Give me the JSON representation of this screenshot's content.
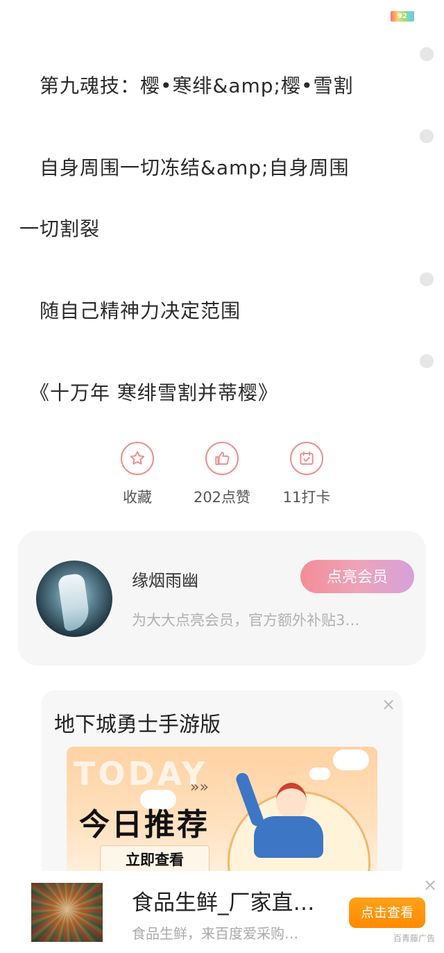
{
  "status": {
    "battery": "92"
  },
  "content": {
    "paragraphs": [
      "　第九魂技：樱•寒绯&amp;樱•雪割",
      "　自身周围一切冻结&amp;自身周围",
      "一切割裂",
      "　随自己精神力决定范围",
      "　《十万年 寒绯雪割并蒂樱》"
    ]
  },
  "actions": [
    {
      "icon": "star-icon",
      "label": "收藏"
    },
    {
      "icon": "thumbs-up-icon",
      "label": "202点赞"
    },
    {
      "icon": "calendar-check-icon",
      "label": "11打卡"
    }
  ],
  "author": {
    "name": "缘烟雨幽",
    "subtitle": "为大大点亮会员，官方额外补贴3…",
    "vip_button": "点亮会员"
  },
  "ad_card": {
    "title": "地下城勇士手游版",
    "banner_bg_text": "TODAY",
    "banner_arrows": "»»",
    "banner_main": "今日推荐",
    "banner_cta": "立即查看",
    "close": "×"
  },
  "bottom_ad": {
    "title": "食品生鲜_厂家直…",
    "desc": "食品生鲜，来百度爱采购…",
    "button": "点击查看",
    "source": "百青藤广告",
    "close": "×"
  },
  "colors": {
    "accent_pink": "#f08c8c",
    "vip_gradient_start": "#f28d97",
    "vip_gradient_end": "#d6a1db",
    "cta_orange": "#ff8a00"
  }
}
